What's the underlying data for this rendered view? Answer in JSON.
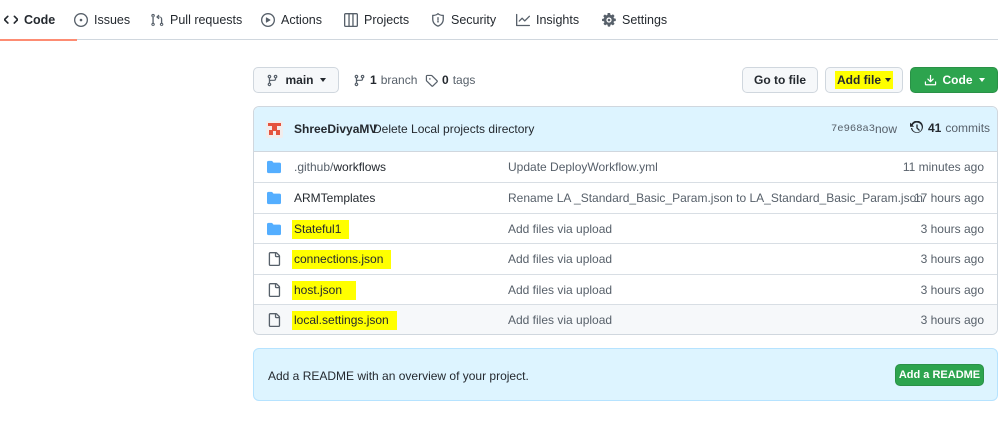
{
  "nav": {
    "tabs": [
      {
        "label": "Code",
        "icon": "code-icon"
      },
      {
        "label": "Issues",
        "icon": "issue-icon"
      },
      {
        "label": "Pull requests",
        "icon": "pull-request-icon"
      },
      {
        "label": "Actions",
        "icon": "play-icon"
      },
      {
        "label": "Projects",
        "icon": "table-icon"
      },
      {
        "label": "Security",
        "icon": "shield-icon"
      },
      {
        "label": "Insights",
        "icon": "graph-icon"
      },
      {
        "label": "Settings",
        "icon": "gear-icon"
      }
    ]
  },
  "toolbar": {
    "branch_label": "main",
    "branch_count": "1",
    "branch_word": "branch",
    "tag_count": "0",
    "tag_word": "tags",
    "go_to_file": "Go to file",
    "add_file": "Add file",
    "code_button": "Code"
  },
  "commit": {
    "author": "ShreeDivyaMV",
    "message": "Delete Local projects directory",
    "sha": "7e968a3",
    "time": "now",
    "count": "41",
    "count_word": "commits"
  },
  "files": [
    {
      "type": "folder",
      "name": ".github/",
      "name_suffix": "workflows",
      "message": "Update DeployWorkflow.yml",
      "time": "11 minutes ago",
      "highlight": false
    },
    {
      "type": "folder",
      "name": "ARMTemplates",
      "name_suffix": "",
      "message": "Rename LA _Standard_Basic_Param.json to LA_Standard_Basic_Param.json",
      "time": "17 hours ago",
      "highlight": false
    },
    {
      "type": "folder",
      "name": "Stateful1",
      "name_suffix": "",
      "message": "Add files via upload",
      "time": "3 hours ago",
      "highlight": true
    },
    {
      "type": "file",
      "name": "connections.json",
      "name_suffix": "",
      "message": "Add files via upload",
      "time": "3 hours ago",
      "highlight": true
    },
    {
      "type": "file",
      "name": "host.json",
      "name_suffix": "",
      "message": "Add files via upload",
      "time": "3 hours ago",
      "highlight": true
    },
    {
      "type": "file",
      "name": "local.settings.json",
      "name_suffix": "",
      "message": "Add files via upload",
      "time": "3 hours ago",
      "highlight": true
    }
  ],
  "readme": {
    "text": "Add a README with an overview of your project.",
    "button": "Add a README"
  },
  "colors": {
    "accent_green": "#2da44e",
    "folder_blue": "#54aeff",
    "highlight_yellow": "#ffff00",
    "active_tab_underline": "#fd8c73",
    "info_bg": "#ddf4ff"
  }
}
